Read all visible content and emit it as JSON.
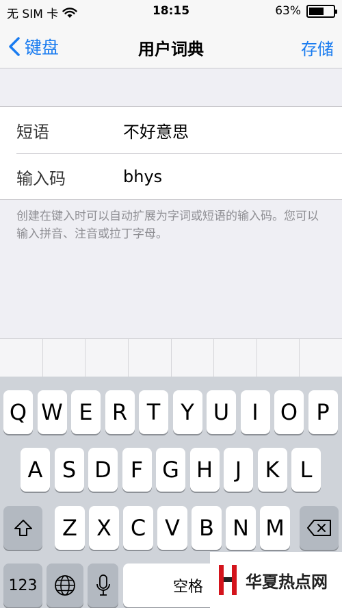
{
  "status_bar": {
    "carrier": "无 SIM 卡",
    "time": "18:15",
    "battery_percent": "63%",
    "battery_level": 0.63
  },
  "nav": {
    "back_label": "键盘",
    "title": "用户词典",
    "save_label": "存储"
  },
  "form": {
    "phrase_label": "短语",
    "phrase_value": "不好意思",
    "shortcut_label": "输入码",
    "shortcut_value": "bhys",
    "footnote": "创建在键入时可以自动扩展为字词或短语的输入码。您可以输入拼音、注音或拉丁字母。"
  },
  "keyboard": {
    "row1": [
      "Q",
      "W",
      "E",
      "R",
      "T",
      "Y",
      "U",
      "I",
      "O",
      "P"
    ],
    "row2": [
      "A",
      "S",
      "D",
      "F",
      "G",
      "H",
      "J",
      "K",
      "L"
    ],
    "row3": [
      "Z",
      "X",
      "C",
      "V",
      "B",
      "N",
      "M"
    ],
    "numbers_label": "123",
    "space_label": "空格"
  },
  "watermark": {
    "text": "华夏热点网"
  },
  "icons": {
    "wifi": "wifi-icon",
    "battery": "battery-icon",
    "back": "chevron-left-icon",
    "shift": "shift-icon",
    "delete": "delete-icon",
    "globe": "globe-icon",
    "mic": "microphone-icon"
  },
  "colors": {
    "accent": "#1a7cf0",
    "background": "#efeff4",
    "keyboard": "#cfd3d9"
  }
}
